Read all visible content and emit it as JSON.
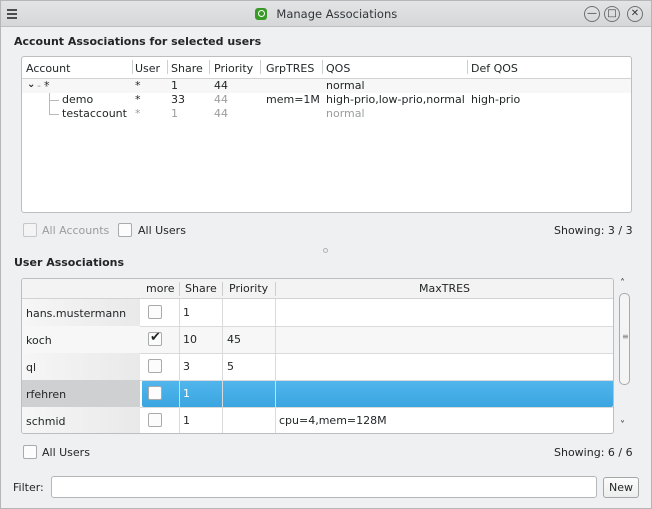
{
  "window": {
    "title": "Manage Associations"
  },
  "account_section": {
    "title": "Account Associations for selected users",
    "columns": [
      "Account",
      "User",
      "Share",
      "Priority",
      "GrpTRES",
      "QOS",
      "Def QOS"
    ],
    "rows": [
      {
        "account": "*",
        "user": "*",
        "share": "1",
        "priority": "44",
        "grptres": "",
        "qos": "normal",
        "defqos": ""
      },
      {
        "account": "demo",
        "user": "*",
        "share": "33",
        "priority": "44",
        "grptres": "mem=1M",
        "qos": "high-prio,low-prio,normal",
        "defqos": "high-prio"
      },
      {
        "account": "testaccount",
        "user": "*",
        "share": "1",
        "priority": "44",
        "grptres": "",
        "qos": "normal",
        "defqos": ""
      }
    ],
    "all_accounts_label": "All Accounts",
    "all_users_label": "All Users",
    "showing": "Showing: 3 / 3"
  },
  "user_section": {
    "title": "User Associations",
    "columns": [
      "more",
      "Share",
      "Priority",
      "MaxTRES"
    ],
    "rows": [
      {
        "user": "hans.mustermann",
        "more": false,
        "share": "1",
        "priority": "",
        "maxtres": ""
      },
      {
        "user": "koch",
        "more": true,
        "share": "10",
        "priority": "45",
        "maxtres": ""
      },
      {
        "user": "ql",
        "more": false,
        "share": "3",
        "priority": "5",
        "maxtres": ""
      },
      {
        "user": "rfehren",
        "more": false,
        "share": "1",
        "priority": "",
        "maxtres": ""
      },
      {
        "user": "schmid",
        "more": false,
        "share": "1",
        "priority": "",
        "maxtres": "cpu=4,mem=128M"
      }
    ],
    "all_users_label": "All Users",
    "showing": "Showing: 6 / 6"
  },
  "filter": {
    "label": "Filter:",
    "value": "",
    "new_button": "New"
  },
  "colors": {
    "selection": "#3daee9",
    "accent": "#3daee9"
  }
}
